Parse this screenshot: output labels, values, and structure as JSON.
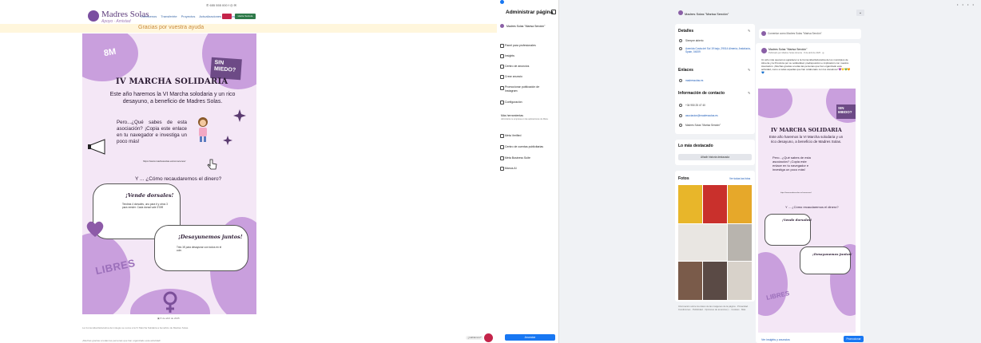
{
  "website": {
    "logo_title": "Madres Solas",
    "logo_subtitle": "Apoyo · Amistad",
    "top_info": "✆ 655 555 000   f  ◎  ✉",
    "nav": [
      "Conócenos",
      "Transferirte",
      "Proyectos",
      "Actualizaciones",
      "Socios/donantes"
    ],
    "member_label": "Hazte Socio/a",
    "thanks": "Gracias por vuestra ayuda",
    "poster": {
      "tag": "8M",
      "badge": "SIN MIEDO?",
      "title": "IV MARCHA SOLIDARIA",
      "subtitle": "Este año haremos la VI Marcha solodaria y un rico desayuno, a  beneficio de Madres Solas.",
      "question": "Pero...¿Qué sabes de esta asociación?  ¡Copia  este enlace en tu navegador e investiga un poco más!",
      "url": "https://www.madressolas.es/conocenos/",
      "how": "Y ... ¿Cómo recaudaremos el dinero?",
      "card1_title": "¡Vende dorsales!",
      "card1_body": "Tendrás 4 dorsales, uno para ti y otros 3 para vender. Cada dorsal vale 3'00€",
      "card2_title": "¡Desayunemos juntos!",
      "card2_body": "Tres 1€ para desayunar con todos en el cole.",
      "libres": "LIBRES"
    },
    "caption": "▣ 8 de abril de 2025",
    "paragraph1": "La Comunidad Educativa del colegio se suma a la IV Marcha Solidaria a beneficio de Madres Solas.",
    "paragraph2": "¡Muchas gracias a todas las personas que han organizado esta actividad!",
    "chat_label": "¿Hablamos?"
  },
  "fb_sidebar": {
    "title": "Administrar página",
    "page_name": "Madres Solas \"Marisa Sendón\"",
    "items": [
      "Panel para profesionales",
      "Insights",
      "Centro de anuncios",
      "Crear anuncio",
      "Promocionar publicación de Instagram",
      "Configuración"
    ],
    "tools_heading": "Más herramientas",
    "tools_sub": "Administra tu empresa en las aplicaciones de Meta.",
    "tools": [
      "Meta Verified",
      "Centro de cuentas publicitarias",
      "Meta Business Suite",
      "Manus AI"
    ],
    "promote_label": "Anunciar"
  },
  "fb_main": {
    "page_name": "Madres Solas \"Marisa Sendón\"",
    "details_title": "Detalles",
    "details": [
      "Siempre abierto",
      "Avenida Costa del Sol 19 bajo, 29014 Almería, Andalucía, Spain, 04009"
    ],
    "links_title": "Enlaces",
    "links": [
      "madressolas.es"
    ],
    "contact_title": "Información de contacto",
    "contact": [
      "+34 950 25 47 40",
      "asociacion@madressolas.es",
      "Madres Solas \"Marisa Sendón\""
    ],
    "featured_title": "Lo más destacado",
    "featured_btn": "Añadir historia destacada",
    "photos_title": "Fotos",
    "photos_link": "Ver todas las fotos",
    "photos_foot": "Información sobre los datos de las imágenes de la página · Privacidad · Condiciones · Publicidad · Opciones de anuncios ▷ · Cookies · Más",
    "composer": "Comentar como Madres Solas \"Marisa Sendón\"",
    "post_name": "Madres Solas \"Marisa Sendón\"",
    "post_meta": "Publicado por Madres Solas Almería · 8 de abril de 2025 · ◍",
    "post_text": "Un año más queremos agradecer a la Comunidad Educativa de los municipios de Almería y la Provincia por su solidaridad, predisposición e implicación con nuestra Asociación. ¡Muchas gracias a todas las personas que han organizado esta actividad, como a todas aquellas que han colaborado con los donativos! 💜💛💚🧡💙",
    "insights_link": "Ver insights y anuncios",
    "promote_btn": "Promocionar"
  },
  "colors": {
    "fb_blue": "#1877f2",
    "poster_purple": "#c99fdd",
    "brand_red": "#c4244a",
    "brand_green": "#2f7a4a"
  }
}
